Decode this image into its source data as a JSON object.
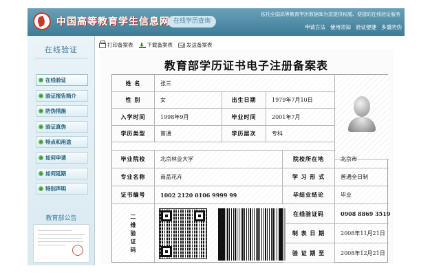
{
  "header": {
    "site_title": "中国高等教育学生信息网",
    "badge": "在线学历查询",
    "tagline": "依托全国高等教育学历数据库为您提供权威、便捷的在线验证服务",
    "nav": [
      "申请方法",
      "使用须知",
      "验证便捷",
      "多重防伪"
    ]
  },
  "sidebar": {
    "title": "在线验证",
    "items": [
      {
        "label": "在线验证"
      },
      {
        "label": "验证报告简介"
      },
      {
        "label": "防伪措施"
      },
      {
        "label": "验证真伪"
      },
      {
        "label": "特点和用途"
      },
      {
        "label": "如何申请"
      },
      {
        "label": "如何延期"
      },
      {
        "label": "特别声明"
      }
    ],
    "notice_title": "教育部公告"
  },
  "toolbar": {
    "print": "打印备案表",
    "download": "下载备案表",
    "send": "发送备案表"
  },
  "certificate": {
    "title": "教育部学历证书电子注册备案表",
    "labels": {
      "name": "姓 名",
      "gender": "性 别",
      "birth": "出生日期",
      "enroll": "入学时间",
      "graduate_time": "毕业时间",
      "edu_type": "学历类型",
      "edu_level": "学历层次",
      "school": "毕业院校",
      "school_location": "院校所在地",
      "major": "专业名称",
      "study_form": "学 习 形 式",
      "cert_no": "证书编号",
      "conclusion": "毕结业结论",
      "code_chars": [
        "二",
        "维",
        "验",
        "证",
        "码"
      ],
      "verify_code": "在线验证码",
      "issue_date": "制 表 日 期",
      "valid_until": "验 证 期 至"
    },
    "values": {
      "name": "张三",
      "gender": "女",
      "birth": "1979年7月10日",
      "enroll": "1998年9月",
      "graduate_time": "2001年7月",
      "edu_type": "普通",
      "edu_level": "专科",
      "school": "北京林业大学",
      "school_location": "北京市",
      "major": "商品花卉",
      "study_form": "普通全日制",
      "cert_no": "1002 2120 0106 9999 99",
      "conclusion": "毕业",
      "verify_code": "0908 8869 3519",
      "issue_date": "2008年11月21日",
      "valid_until": "2008年12月21日"
    }
  }
}
